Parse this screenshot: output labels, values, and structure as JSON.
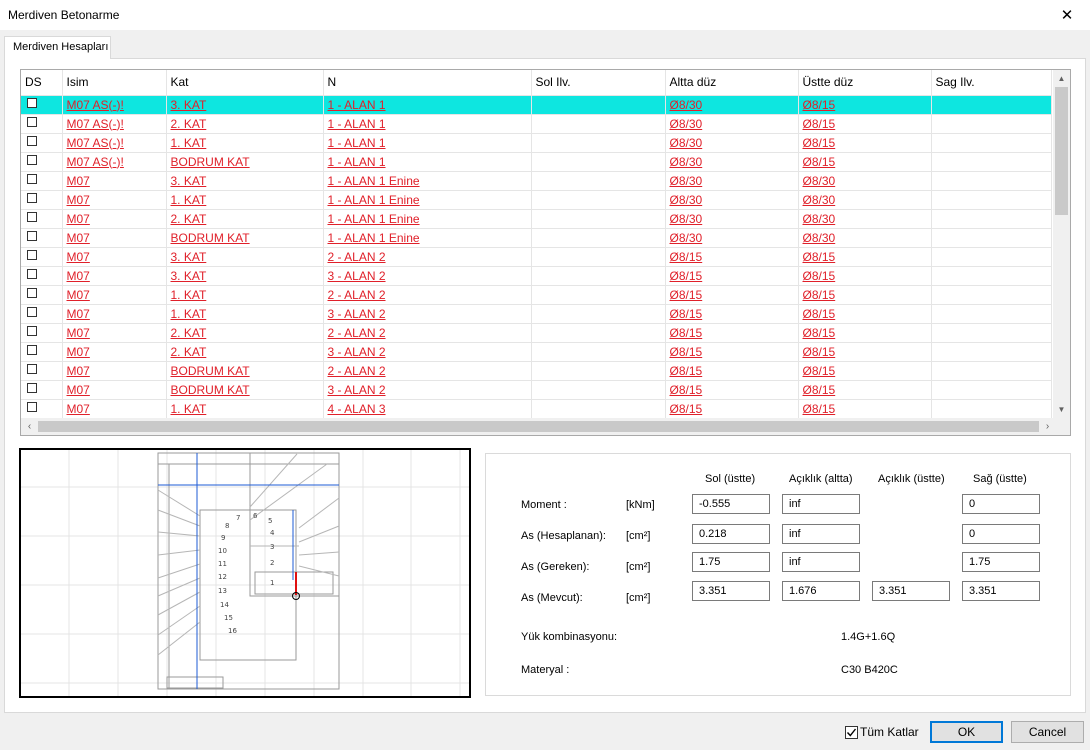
{
  "window": {
    "title": "Merdiven Betonarme",
    "close_glyph": "✕"
  },
  "tabs": [
    {
      "label": "Merdiven Hesapları"
    }
  ],
  "grid": {
    "columns": [
      "DS",
      "Isim",
      "Kat",
      "N",
      "Sol Ilv.",
      "Altta düz",
      "Üstte düz",
      "Sag Ilv."
    ],
    "rows": [
      {
        "isim": "M07 AS(-)!",
        "kat": "3. KAT",
        "n": "1 - ALAN 1",
        "altta": "Ø8/30",
        "ustte": "Ø8/15",
        "selected": true
      },
      {
        "isim": "M07 AS(-)!",
        "kat": "2. KAT",
        "n": "1 - ALAN 1",
        "altta": "Ø8/30",
        "ustte": "Ø8/15"
      },
      {
        "isim": "M07 AS(-)!",
        "kat": "1. KAT",
        "n": "1 - ALAN 1",
        "altta": "Ø8/30",
        "ustte": "Ø8/15"
      },
      {
        "isim": "M07 AS(-)!",
        "kat": "BODRUM KAT",
        "n": "1 - ALAN 1",
        "altta": "Ø8/30",
        "ustte": "Ø8/15"
      },
      {
        "isim": "M07",
        "kat": "3. KAT",
        "n": "1 - ALAN 1 Enine",
        "altta": "Ø8/30",
        "ustte": "Ø8/30"
      },
      {
        "isim": "M07",
        "kat": "1. KAT",
        "n": "1 - ALAN 1 Enine",
        "altta": "Ø8/30",
        "ustte": "Ø8/30"
      },
      {
        "isim": "M07",
        "kat": "2. KAT",
        "n": "1 - ALAN 1 Enine",
        "altta": "Ø8/30",
        "ustte": "Ø8/30"
      },
      {
        "isim": "M07",
        "kat": "BODRUM KAT",
        "n": "1 - ALAN 1 Enine",
        "altta": "Ø8/30",
        "ustte": "Ø8/30"
      },
      {
        "isim": "M07",
        "kat": "3. KAT",
        "n": "2 - ALAN 2",
        "altta": "Ø8/15",
        "ustte": "Ø8/15"
      },
      {
        "isim": "M07",
        "kat": "3. KAT",
        "n": "3 - ALAN 2",
        "altta": "Ø8/15",
        "ustte": "Ø8/15"
      },
      {
        "isim": "M07",
        "kat": "1. KAT",
        "n": "2 - ALAN 2",
        "altta": "Ø8/15",
        "ustte": "Ø8/15"
      },
      {
        "isim": "M07",
        "kat": "1. KAT",
        "n": "3 - ALAN 2",
        "altta": "Ø8/15",
        "ustte": "Ø8/15"
      },
      {
        "isim": "M07",
        "kat": "2. KAT",
        "n": "2 - ALAN 2",
        "altta": "Ø8/15",
        "ustte": "Ø8/15"
      },
      {
        "isim": "M07",
        "kat": "2. KAT",
        "n": "3 - ALAN 2",
        "altta": "Ø8/15",
        "ustte": "Ø8/15"
      },
      {
        "isim": "M07",
        "kat": "BODRUM KAT",
        "n": "2 - ALAN 2",
        "altta": "Ø8/15",
        "ustte": "Ø8/15"
      },
      {
        "isim": "M07",
        "kat": "BODRUM KAT",
        "n": "3 - ALAN 2",
        "altta": "Ø8/15",
        "ustte": "Ø8/15"
      },
      {
        "isim": "M07",
        "kat": "1. KAT",
        "n": "4 - ALAN 3",
        "altta": "Ø8/15",
        "ustte": "Ø8/15"
      }
    ]
  },
  "preview": {
    "step_numbers": [
      "1",
      "2",
      "3",
      "4",
      "5",
      "6",
      "7",
      "8",
      "9",
      "10",
      "11",
      "12",
      "13",
      "14",
      "15",
      "16"
    ]
  },
  "results": {
    "headers": [
      "Sol (üstte)",
      "Açıklık (altta)",
      "Açıklık (üstte)",
      "Sağ (üstte)"
    ],
    "rows": [
      {
        "label": "Moment :",
        "unit": "[kNm]",
        "values": [
          "-0.555",
          "inf",
          null,
          "0"
        ]
      },
      {
        "label": "As (Hesaplanan):",
        "unit": "[cm²]",
        "values": [
          "0.218",
          "inf",
          null,
          "0"
        ]
      },
      {
        "label": "As (Gereken):",
        "unit": "[cm²]",
        "values": [
          "1.75",
          "inf",
          null,
          "1.75"
        ]
      },
      {
        "label": "As (Mevcut):",
        "unit": "[cm²]",
        "values": [
          "3.351",
          "1.676",
          "3.351",
          "3.351"
        ]
      }
    ],
    "yuk_label": "Yük kombinasyonu:",
    "yuk_value": "1.4G+1.6Q",
    "materyal_label": "Materyal :",
    "materyal_value": "C30 B420C"
  },
  "footer": {
    "tum_katlar_label": "Tüm Katlar",
    "tum_katlar_checked": true,
    "ok_label": "OK",
    "cancel_label": "Cancel"
  }
}
